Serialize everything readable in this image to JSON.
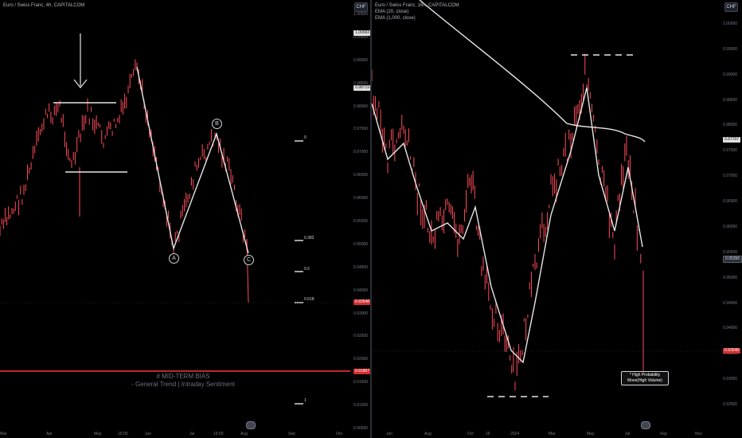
{
  "left": {
    "legend": "Euro / Swiss Franc, 4h, CAPITALCOM",
    "currency": "CHF",
    "y_ticks": [
      "1.00500",
      "0.99500",
      "0.99000",
      "0.98500",
      "0.98000",
      "0.97500",
      "0.97000",
      "0.96500",
      "0.96000",
      "0.95500",
      "0.95000",
      "0.94500",
      "0.94000",
      "0.93000",
      "0.92500",
      "0.92000",
      "0.91500",
      "0.91000",
      "0.90500"
    ],
    "price_tags": {
      "hi": "1.00093",
      "mid": "0.98719",
      "last": "0.93548",
      "bias": "0.91867"
    },
    "x_ticks": [
      "Mar",
      "Apr",
      "May",
      "15:00",
      "Jun",
      "Jul",
      "15:00",
      "Aug",
      "Sep",
      "Oct"
    ],
    "fib": [
      "0",
      "0.382",
      "0.5",
      "0.618",
      "1"
    ],
    "wave": {
      "a": "A",
      "b": "B",
      "c": "C"
    },
    "bias_title": "# MID-TERM BIAS",
    "bias_sub": "- General Trend  |  Intraday Sentiment"
  },
  "right": {
    "legend": [
      "Euro / Swiss Franc, 16h, CAPITALCOM",
      "EMA (20, close)",
      "EMA (1,000, close)"
    ],
    "currency": "CHF",
    "y_ticks": [
      "1.00000",
      "0.99500",
      "0.99000",
      "0.98500",
      "0.98000",
      "0.97500",
      "0.97000",
      "0.96500",
      "0.96000",
      "0.95500",
      "0.95000",
      "0.94500",
      "0.94000",
      "0.93500",
      "0.93000",
      "0.92500"
    ],
    "price_tags": {
      "ema": "0.97707",
      "ema20": "0.95356",
      "last": "0.93548"
    },
    "x_ticks": [
      "Jun",
      "Aug",
      "Oct",
      "15",
      "2024",
      "Mar",
      "May",
      "Jul",
      "Sep",
      "Nov"
    ],
    "annotation": [
      "* High Probability",
      "Move(High Volume)"
    ]
  },
  "colors": {
    "bg": "#000000",
    "candle": "#ff4d5a",
    "line": "#e6e6e6",
    "bias_line": "#c2252e"
  }
}
